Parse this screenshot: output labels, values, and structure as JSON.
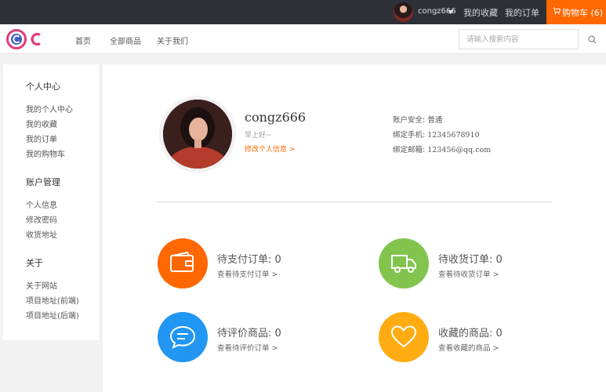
{
  "topbar": {
    "username": "congz666",
    "favorites": "我的收藏",
    "orders": "我的订单",
    "cart": "购物车 (6)"
  },
  "header": {
    "nav": [
      "首页",
      "全部商品",
      "关于我们"
    ],
    "search_placeholder": "请输入搜索内容"
  },
  "sidebar": {
    "sections": [
      {
        "title": "个人中心",
        "items": [
          "我的个人中心",
          "我的收藏",
          "我的订单",
          "我的购物车"
        ]
      },
      {
        "title": "账户管理",
        "items": [
          "个人信息",
          "修改密码",
          "收货地址"
        ]
      },
      {
        "title": "关于",
        "items": [
          "关于网站",
          "项目地址(前端)",
          "项目地址(后端)"
        ]
      }
    ]
  },
  "profile": {
    "name": "congz666",
    "greeting": "早上好~",
    "edit": "修改个人信息 >",
    "security_label": "账户安全:",
    "security_value": "普通",
    "phone_label": "绑定手机:",
    "phone_value": "12345678910",
    "email_label": "绑定邮箱:",
    "email_value": "123456@qq.com"
  },
  "stats": [
    {
      "title": "待支付订单: 0",
      "link": "查看待支付订单 >",
      "color": "#ff6700",
      "icon": "wallet-icon"
    },
    {
      "title": "待收货订单: 0",
      "link": "查看待收货订单 >",
      "color": "#83c44e",
      "icon": "truck-icon"
    },
    {
      "title": "待评价商品: 0",
      "link": "查看待评价订单 >",
      "color": "#2196f3",
      "icon": "chat-icon"
    },
    {
      "title": "收藏的商品: 0",
      "link": "查看收藏的商品 >",
      "color": "#ffac13",
      "icon": "heart-icon"
    }
  ],
  "colors": {
    "accent": "#ff6700",
    "topbar": "#2e3037"
  }
}
